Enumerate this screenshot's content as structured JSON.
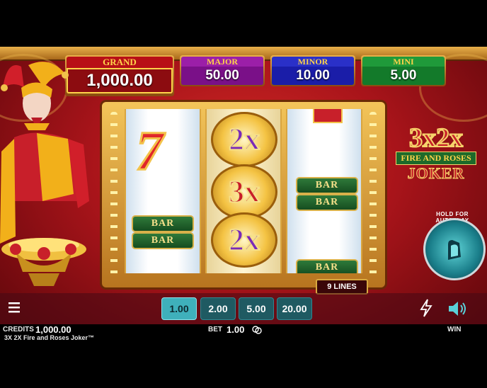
{
  "jackpots": {
    "grand": {
      "label": "GRAND",
      "value": "1,000.00"
    },
    "major": {
      "label": "MAJOR",
      "value": "50.00"
    },
    "minor": {
      "label": "MINOR",
      "value": "10.00"
    },
    "mini": {
      "label": "MINI",
      "value": "5.00"
    }
  },
  "reels": {
    "reel1": {
      "seven": "7",
      "bars": [
        "BAR",
        "BAR"
      ]
    },
    "reel2": {
      "multipliers": [
        "2x",
        "3x",
        "2x"
      ]
    },
    "reel3": {
      "bars": [
        "BAR",
        "BAR",
        "BAR"
      ]
    }
  },
  "lines_badge": "9 LINES",
  "logo": {
    "line1": "3x2x",
    "line2": "FIRE AND ROSES",
    "line3": "JOKER"
  },
  "autoplay_label": "HOLD FOR AUTOPLAY",
  "bet_options": [
    "1.00",
    "2.00",
    "5.00",
    "20.00"
  ],
  "selected_bet": "1.00",
  "footer": {
    "credits_label": "CREDITS",
    "credits_value": "1,000.00",
    "bet_label": "BET",
    "bet_value": "1.00",
    "win_label": "WIN",
    "game_title": "3X 2X Fire and Roses Joker™"
  },
  "colors": {
    "accent": "#3fb0bb",
    "frame_gold": "#f3c55a",
    "background_red": "#a8141a"
  }
}
